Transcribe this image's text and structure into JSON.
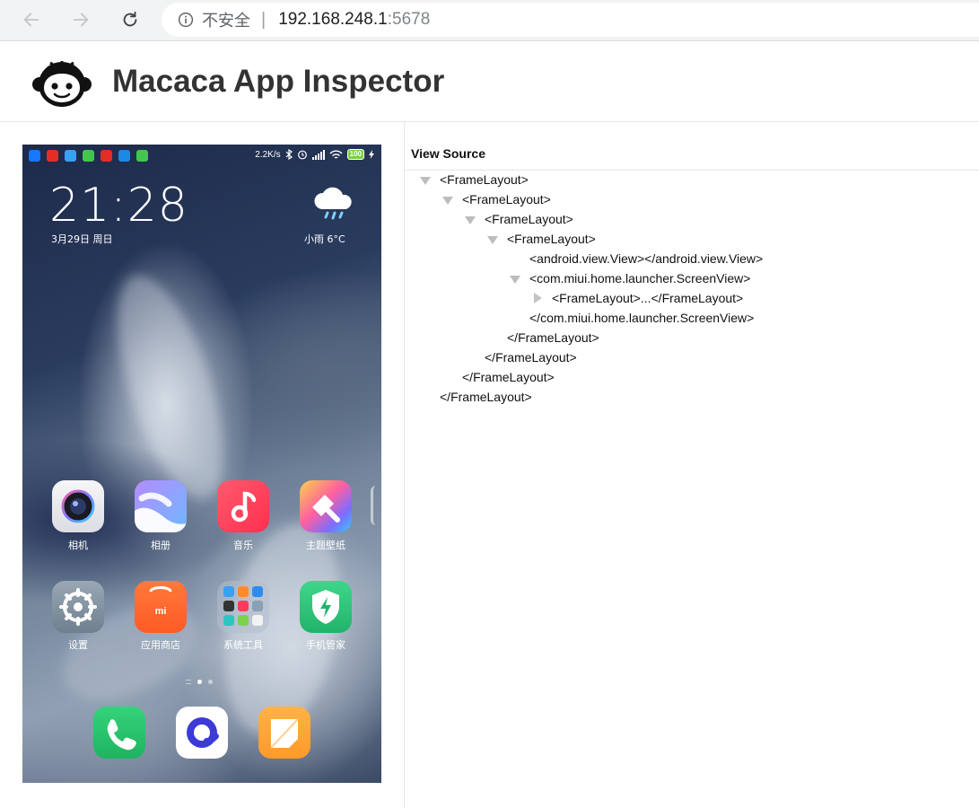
{
  "browser": {
    "security_text": "不安全",
    "separator": "|",
    "host": "192.168.248.1",
    "port": ":5678",
    "icons": [
      "back-arrow-icon",
      "forward-arrow-icon",
      "reload-icon",
      "info-icon"
    ]
  },
  "app": {
    "title": "Macaca App Inspector",
    "logo": "monkey-logo-icon"
  },
  "phone": {
    "status_bar": {
      "speed": "2.2K/s",
      "battery": "100"
    },
    "clock": "21:28",
    "date": "3月29日 周日",
    "weather": "小雨  6°C",
    "apps": [
      {
        "label": "相机",
        "icon": "camera-icon"
      },
      {
        "label": "相册",
        "icon": "gallery-icon"
      },
      {
        "label": "音乐",
        "icon": "music-icon"
      },
      {
        "label": "主题壁纸",
        "icon": "themes-icon"
      },
      {
        "label": "设置",
        "icon": "settings-gear-icon"
      },
      {
        "label": "应用商店",
        "icon": "app-store-icon"
      },
      {
        "label": "系统工具",
        "icon": "system-tools-folder-icon"
      },
      {
        "label": "手机管家",
        "icon": "security-shield-icon"
      }
    ],
    "dock": [
      {
        "icon": "phone-icon"
      },
      {
        "icon": "browser-icon"
      },
      {
        "icon": "notes-icon"
      }
    ],
    "colors": {
      "store": "#ff6a2f",
      "security": "#2fc27a",
      "phone": "#25c26a",
      "music": "#ff3d5a"
    }
  },
  "view_source": {
    "title": "View Source",
    "nodes": [
      {
        "text": "<FrameLayout>",
        "toggle": "expanded"
      },
      {
        "text": "<FrameLayout>",
        "toggle": "expanded"
      },
      {
        "text": "<FrameLayout>",
        "toggle": "expanded"
      },
      {
        "text": "<FrameLayout>",
        "toggle": "expanded"
      },
      {
        "text": "<android.view.View></android.view.View>",
        "toggle": "none"
      },
      {
        "text": "<com.miui.home.launcher.ScreenView>",
        "toggle": "expanded"
      },
      {
        "text": "<FrameLayout>...</FrameLayout>",
        "toggle": "collapsed"
      },
      {
        "text": "</com.miui.home.launcher.ScreenView>",
        "toggle": "none"
      },
      {
        "text": "</FrameLayout>",
        "toggle": "none"
      },
      {
        "text": "</FrameLayout>",
        "toggle": "none"
      },
      {
        "text": "</FrameLayout>",
        "toggle": "none"
      },
      {
        "text": "</FrameLayout>",
        "toggle": "none"
      }
    ]
  }
}
